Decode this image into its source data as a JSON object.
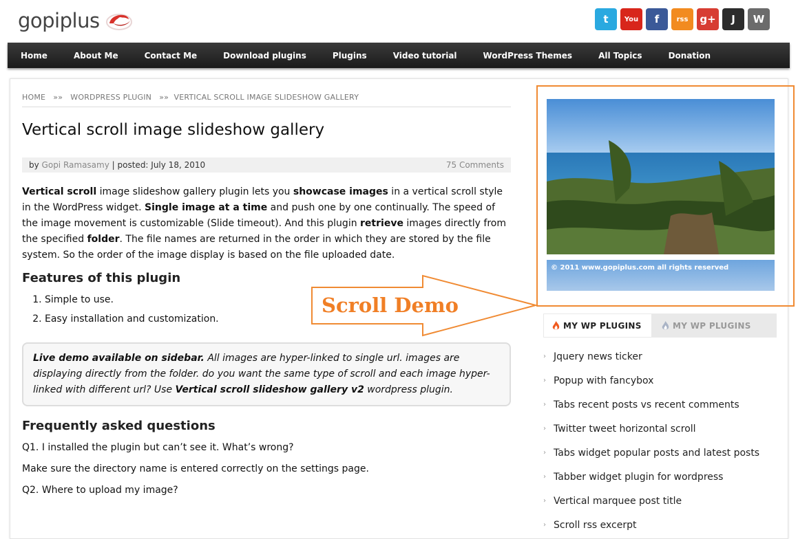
{
  "header": {
    "logo_text": "gopiplus",
    "social": [
      {
        "name": "twitter",
        "label": "t",
        "color": "#2aa9e0"
      },
      {
        "name": "youtube",
        "label": "You",
        "color": "#d8261b"
      },
      {
        "name": "facebook",
        "label": "f",
        "color": "#3b5998"
      },
      {
        "name": "rss",
        "label": "rss",
        "color": "#f28b20"
      },
      {
        "name": "google-plus",
        "label": "g+",
        "color": "#d73d32"
      },
      {
        "name": "joomla",
        "label": "J",
        "color": "#2c2c2c"
      },
      {
        "name": "wordpress",
        "label": "W",
        "color": "#6b6b6b"
      }
    ]
  },
  "nav": {
    "items": [
      "Home",
      "About Me",
      "Contact Me",
      "Download plugins",
      "Plugins",
      "Video tutorial",
      "WordPress Themes",
      "All Topics",
      "Donation"
    ]
  },
  "breadcrumb": {
    "home": "HOME",
    "sep": "»»",
    "category": "WORDPRESS PLUGIN",
    "current": "VERTICAL SCROLL IMAGE SLIDESHOW GALLERY"
  },
  "post": {
    "title": "Vertical scroll image slideshow gallery",
    "meta_by": "by",
    "author": "Gopi Ramasamy",
    "posted": "| posted: July 18, 2010",
    "comments": "75 Comments",
    "intro": {
      "b1": "Vertical scroll",
      "t1": " image slideshow gallery plugin lets you ",
      "b2": "showcase images",
      "t2": " in a vertical scroll style in the WordPress widget. ",
      "b3": "Single image at a time",
      "t3": " and push one by one continually. The speed of the image movement is customizable (Slide timeout). And this plugin ",
      "b4": "retrieve",
      "t4": " images directly from the specified ",
      "b5": "folder",
      "t5": ". The file names are returned in the order in which they are stored by the file system. So the order of the image display is based on the file uploaded date."
    },
    "features_title": "Features of this plugin",
    "features": [
      "Simple to use.",
      "Easy installation and customization."
    ],
    "note": {
      "b1": "Live demo available on sidebar.",
      "t1": " All images are hyper-linked to single url. images are displaying directly from the folder. do you want the same type of scroll and each image hyper-linked with different url? Use ",
      "b2": "Vertical scroll slideshow gallery v2",
      "t2": " wordpress plugin."
    },
    "faq_title": "Frequently asked questions",
    "faq": [
      "Q1. I installed the plugin but can’t see it. What’s wrong?",
      "Make sure the directory name is entered correctly on the settings page.",
      "Q2. Where to upload my image?"
    ]
  },
  "sidebar": {
    "slide_credit": "© 2011 www.gopiplus.com all rights reserved",
    "tabs": [
      "MY WP PLUGINS",
      "MY WP PLUGINS"
    ],
    "plugins": [
      "Jquery news ticker",
      "Popup with fancybox",
      "Tabs recent posts vs recent comments",
      "Twitter tweet horizontal scroll",
      "Tabs widget popular posts and latest posts",
      "Tabber widget plugin for wordpress",
      "Vertical marquee post title",
      "Scroll rss excerpt"
    ]
  },
  "annotation": {
    "label": "Scroll Demo",
    "color": "#f07f26"
  }
}
